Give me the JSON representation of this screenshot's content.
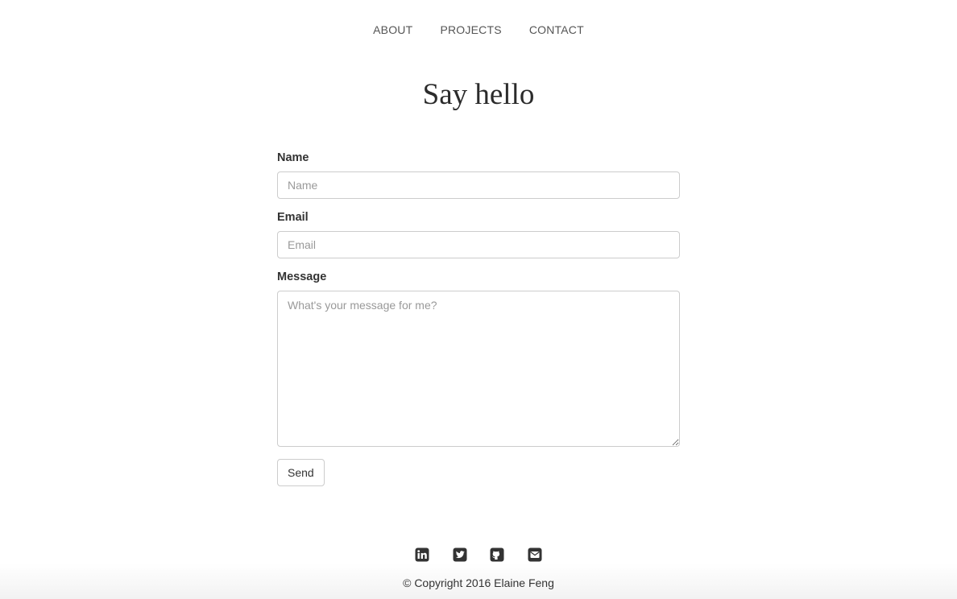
{
  "nav": {
    "items": [
      "ABOUT",
      "PROJECTS",
      "CONTACT"
    ]
  },
  "page": {
    "title": "Say hello"
  },
  "form": {
    "name_label": "Name",
    "name_placeholder": "Name",
    "email_label": "Email",
    "email_placeholder": "Email",
    "message_label": "Message",
    "message_placeholder": "What's your message for me?",
    "send_label": "Send"
  },
  "footer": {
    "social_icons": [
      "linkedin-icon",
      "twitter-icon",
      "github-icon",
      "email-icon"
    ],
    "copyright": "© Copyright 2016 Elaine Feng"
  },
  "colors": {
    "text": "#333333",
    "nav_text": "#555555",
    "border": "#cccccc",
    "placeholder": "#999999"
  }
}
